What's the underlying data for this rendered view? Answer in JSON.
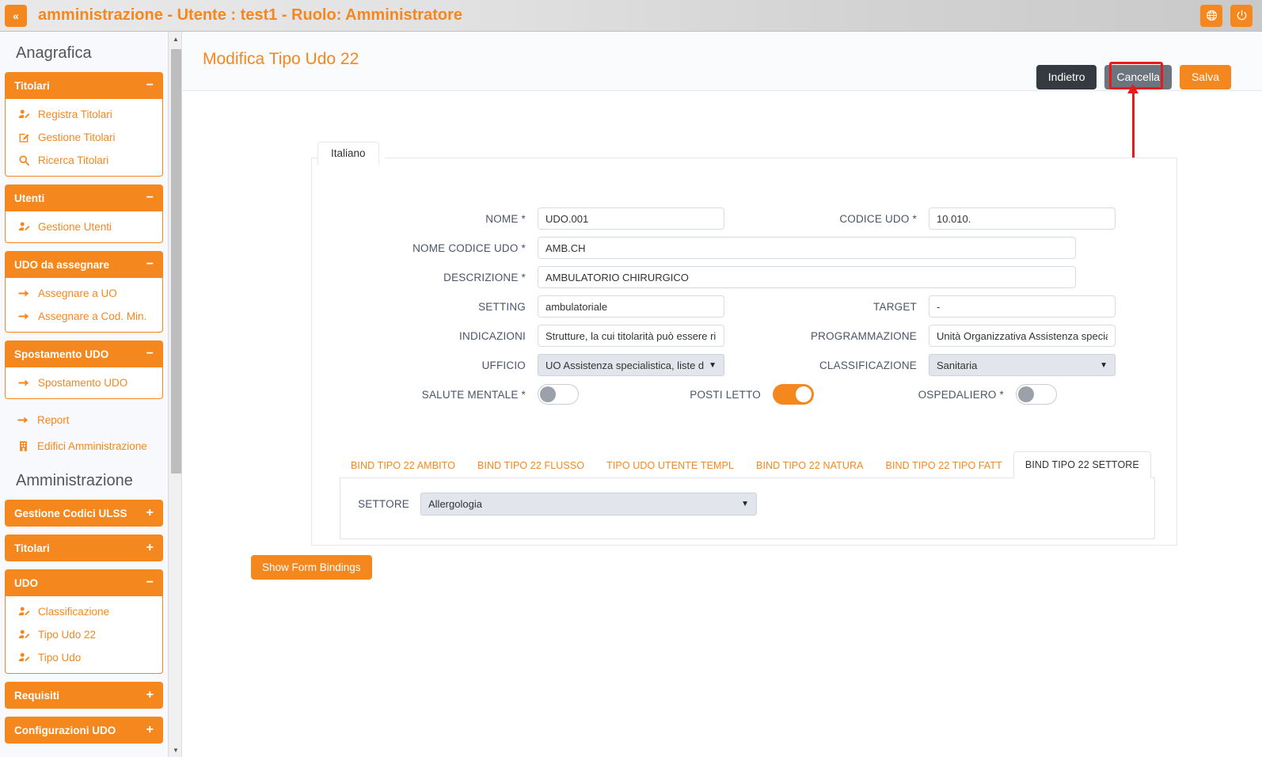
{
  "topbar": {
    "collapse_icon": "double-chevron-left",
    "title": "amministrazione - Utente : test1 - Ruolo: Amministratore",
    "globe_icon": "globe-icon",
    "power_icon": "power-icon",
    "accent_color": "#f5871f"
  },
  "sidebar": {
    "sections": [
      {
        "title": "Anagrafica",
        "groups": [
          {
            "label": "Titolari",
            "sign": "−",
            "expanded": true,
            "items": [
              {
                "label": "Registra Titolari",
                "icon": "user-edit-icon"
              },
              {
                "label": "Gestione Titolari",
                "icon": "edit-square-icon"
              },
              {
                "label": "Ricerca Titolari",
                "icon": "search-icon"
              }
            ]
          },
          {
            "label": "Utenti",
            "sign": "−",
            "expanded": true,
            "items": [
              {
                "label": "Gestione Utenti",
                "icon": "user-edit-icon"
              }
            ]
          },
          {
            "label": "UDO da assegnare",
            "sign": "−",
            "expanded": true,
            "items": [
              {
                "label": "Assegnare a UO",
                "icon": "arrow-right-icon"
              },
              {
                "label": "Assegnare a Cod. Min.",
                "icon": "arrow-right-icon"
              }
            ]
          },
          {
            "label": "Spostamento UDO",
            "sign": "−",
            "expanded": true,
            "items": [
              {
                "label": "Spostamento UDO",
                "icon": "arrow-right-icon"
              }
            ]
          }
        ],
        "plain_items": [
          {
            "label": "Report",
            "icon": "arrow-right-icon"
          },
          {
            "label": "Edifici Amministrazione",
            "icon": "building-icon"
          }
        ]
      },
      {
        "title": "Amministrazione",
        "groups": [
          {
            "label": "Gestione Codici ULSS",
            "sign": "+",
            "expanded": false,
            "items": []
          },
          {
            "label": "Titolari",
            "sign": "+",
            "expanded": false,
            "items": []
          },
          {
            "label": "UDO",
            "sign": "−",
            "expanded": true,
            "items": [
              {
                "label": "Classificazione",
                "icon": "user-edit-icon"
              },
              {
                "label": "Tipo Udo 22",
                "icon": "user-edit-icon"
              },
              {
                "label": "Tipo Udo",
                "icon": "user-edit-icon"
              }
            ]
          },
          {
            "label": "Requisiti",
            "sign": "+",
            "expanded": false,
            "items": []
          },
          {
            "label": "Configurazioni UDO",
            "sign": "+",
            "expanded": false,
            "items": []
          }
        ],
        "plain_items": []
      }
    ],
    "scrollbar": {
      "up_arrow": "caret-up-icon",
      "down_arrow": "caret-down-icon"
    }
  },
  "page": {
    "title": "Modifica Tipo Udo 22",
    "actions": {
      "back": "Indietro",
      "cancel": "Cancella",
      "save": "Salva"
    },
    "annotation": {
      "target": "Cancella",
      "color": "#e8191b"
    }
  },
  "form": {
    "language_tab": "Italiano",
    "fields": {
      "nome": {
        "label": "NOME *",
        "value": "UDO.001"
      },
      "codice_udo": {
        "label": "CODICE UDO *",
        "value": "10.010."
      },
      "nome_codice_udo": {
        "label": "NOME CODICE UDO *",
        "value": "AMB.CH"
      },
      "descrizione": {
        "label": "DESCRIZIONE *",
        "value": "AMBULATORIO CHIRURGICO"
      },
      "setting": {
        "label": "SETTING",
        "value": "ambulatoriale"
      },
      "target": {
        "label": "TARGET",
        "value": "-"
      },
      "indicazioni": {
        "label": "INDICAZIONI",
        "value": "Strutture, la cui titolarità può essere ri"
      },
      "programmazione": {
        "label": "PROGRAMMAZIONE",
        "value": "Unità Organizzativa Assistenza specia"
      },
      "ufficio": {
        "label": "UFFICIO",
        "value": "UO Assistenza specialistica, liste d"
      },
      "classificazione": {
        "label": "CLASSIFICAZIONE",
        "value": "Sanitaria"
      },
      "salute_mentale": {
        "label": "SALUTE MENTALE *",
        "state": "off"
      },
      "posti_letto": {
        "label": "POSTI LETTO",
        "state": "on"
      },
      "ospedaliero": {
        "label": "OSPEDALIERO *",
        "state": "off"
      }
    }
  },
  "bind_tabs": [
    {
      "label": "BIND TIPO 22 AMBITO",
      "active": false
    },
    {
      "label": "BIND TIPO 22 FLUSSO",
      "active": false
    },
    {
      "label": "TIPO UDO UTENTE TEMPL",
      "active": false
    },
    {
      "label": "BIND TIPO 22 NATURA",
      "active": false
    },
    {
      "label": "BIND TIPO 22 TIPO FATT",
      "active": false
    },
    {
      "label": "BIND TIPO 22 SETTORE",
      "active": true
    }
  ],
  "bind_panel": {
    "settore": {
      "label": "SETTORE",
      "value": "Allergologia"
    }
  },
  "footer": {
    "show_bindings": "Show Form Bindings"
  }
}
